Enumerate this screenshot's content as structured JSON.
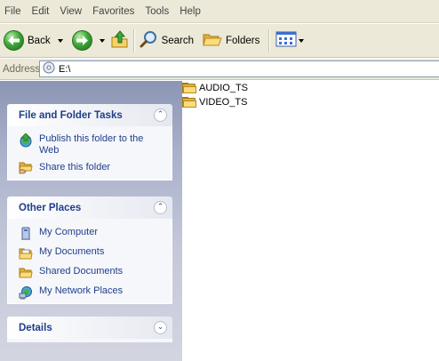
{
  "menubar": {
    "items": [
      "File",
      "Edit",
      "View",
      "Favorites",
      "Tools",
      "Help"
    ]
  },
  "toolbar": {
    "back_label": "Back",
    "search_label": "Search",
    "folders_label": "Folders"
  },
  "address": {
    "label": "Address",
    "value": "E:\\"
  },
  "taskpane": {
    "file_tasks": {
      "title": "File and Folder Tasks",
      "items": [
        {
          "label": "Publish this folder to the Web",
          "icon": "publish-web-icon"
        },
        {
          "label": "Share this folder",
          "icon": "share-folder-icon"
        }
      ]
    },
    "other_places": {
      "title": "Other Places",
      "items": [
        {
          "label": "My Computer",
          "icon": "my-computer-icon"
        },
        {
          "label": "My Documents",
          "icon": "my-documents-icon"
        },
        {
          "label": "Shared Documents",
          "icon": "shared-documents-icon"
        },
        {
          "label": "My Network Places",
          "icon": "network-places-icon"
        }
      ]
    },
    "details": {
      "title": "Details"
    }
  },
  "files": [
    {
      "name": "AUDIO_TS",
      "icon": "folder-icon"
    },
    {
      "name": "VIDEO_TS",
      "icon": "folder-icon"
    }
  ],
  "colors": {
    "chrome": "#ece9d8",
    "task_link": "#1e3e8a",
    "folder": "#f9dc7c"
  }
}
